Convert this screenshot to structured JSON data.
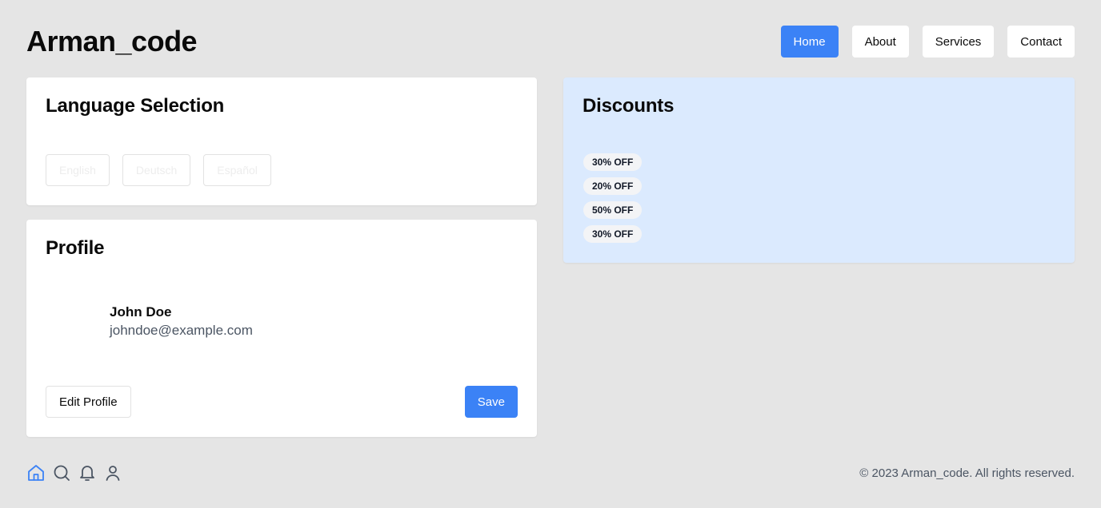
{
  "header": {
    "brand": "Arman_code",
    "nav": [
      {
        "label": "Home",
        "active": true
      },
      {
        "label": "About",
        "active": false
      },
      {
        "label": "Services",
        "active": false
      },
      {
        "label": "Contact",
        "active": false
      }
    ]
  },
  "language_card": {
    "title": "Language Selection",
    "options": [
      "English",
      "Deutsch",
      "Español"
    ]
  },
  "profile_card": {
    "title": "Profile",
    "name": "John Doe",
    "email": "johndoe@example.com",
    "edit_label": "Edit Profile",
    "save_label": "Save"
  },
  "discounts_card": {
    "title": "Discounts",
    "badges": [
      "30% OFF",
      "20% OFF",
      "50% OFF",
      "30% OFF"
    ]
  },
  "footer": {
    "icons": [
      "home-icon",
      "search-icon",
      "bell-icon",
      "user-icon"
    ],
    "copyright": "© 2023 Arman_code. All rights reserved."
  },
  "colors": {
    "accent": "#3b82f6",
    "background": "#e5e5e5",
    "discount_bg": "#dbeafe"
  }
}
